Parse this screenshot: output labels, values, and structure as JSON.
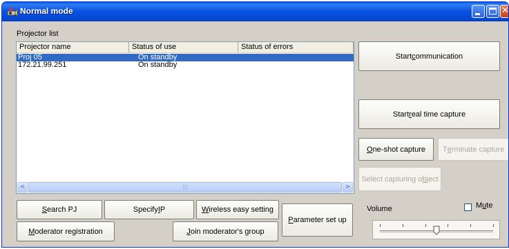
{
  "window": {
    "title": "Normal mode",
    "icon": "projector-app-icon",
    "controls": {
      "minimize": "minimize-icon",
      "maximize": "maximize-icon",
      "close": "close-icon"
    }
  },
  "projector_list": {
    "label": "Projector list",
    "columns": [
      "Projector name",
      "Status of use",
      "Status of errors"
    ],
    "rows": [
      {
        "name": "Proj 05",
        "status_use": "On standby",
        "status_errors": "",
        "selected": true
      },
      {
        "name": "172.21.99.251",
        "status_use": "On standby",
        "status_errors": "",
        "selected": false
      }
    ],
    "scrollbar": {
      "left_arrow": "<",
      "right_arrow": ">",
      "grip": "|||"
    }
  },
  "buttons": {
    "start_communication": {
      "pre": "Start ",
      "key": "c",
      "post": "ommunication"
    },
    "start_realtime": {
      "pre": "Start ",
      "key": "r",
      "post": "eal time capture"
    },
    "oneshot": {
      "pre": "",
      "key": "O",
      "post": "ne-shot capture"
    },
    "terminate": {
      "pre": "T",
      "key": "e",
      "post": "rminate capture"
    },
    "select_object": {
      "pre": "Select capturing o",
      "key": "b",
      "post": "ject"
    },
    "search_pj": {
      "pre": "",
      "key": "S",
      "post": "earch PJ"
    },
    "specify_ip": {
      "pre": "Specify ",
      "key": "I",
      "post": "P"
    },
    "wireless": {
      "pre": "",
      "key": "W",
      "post": "ireless easy setting"
    },
    "moderator_reg": {
      "pre": "",
      "key": "M",
      "post": "oderator registration"
    },
    "join_moderator": {
      "pre": "",
      "key": "J",
      "post": "oin moderator's group"
    },
    "parameter": {
      "pre": "",
      "key": "P",
      "post": "arameter set up"
    }
  },
  "volume": {
    "label": "Volume",
    "level": 0.5
  },
  "mute": {
    "pre": "M",
    "key": "u",
    "post": "te",
    "checked": false
  },
  "colors": {
    "title_bar": "#0851e2",
    "selection": "#316ac5",
    "window_bg": "#d4d0c8"
  }
}
